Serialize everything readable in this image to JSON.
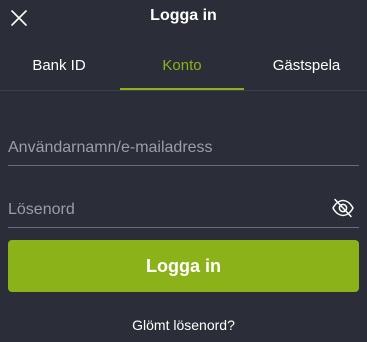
{
  "header": {
    "title": "Logga in",
    "close_icon": "close-icon"
  },
  "tabs": [
    {
      "label": "Bank ID",
      "active": false
    },
    {
      "label": "Konto",
      "active": true
    },
    {
      "label": "Gästspela",
      "active": false
    }
  ],
  "form": {
    "username_placeholder": "Användarnamn/e-mailadress",
    "username_value": "",
    "password_placeholder": "Lösenord",
    "password_value": "",
    "password_toggle_icon": "eye-slash-icon",
    "submit_label": "Logga in",
    "forgot_label": "Glömt lösenord?"
  },
  "colors": {
    "background": "#2b2e38",
    "accent": "#8cb219",
    "text": "#ffffff",
    "placeholder": "#9a9ea8"
  }
}
